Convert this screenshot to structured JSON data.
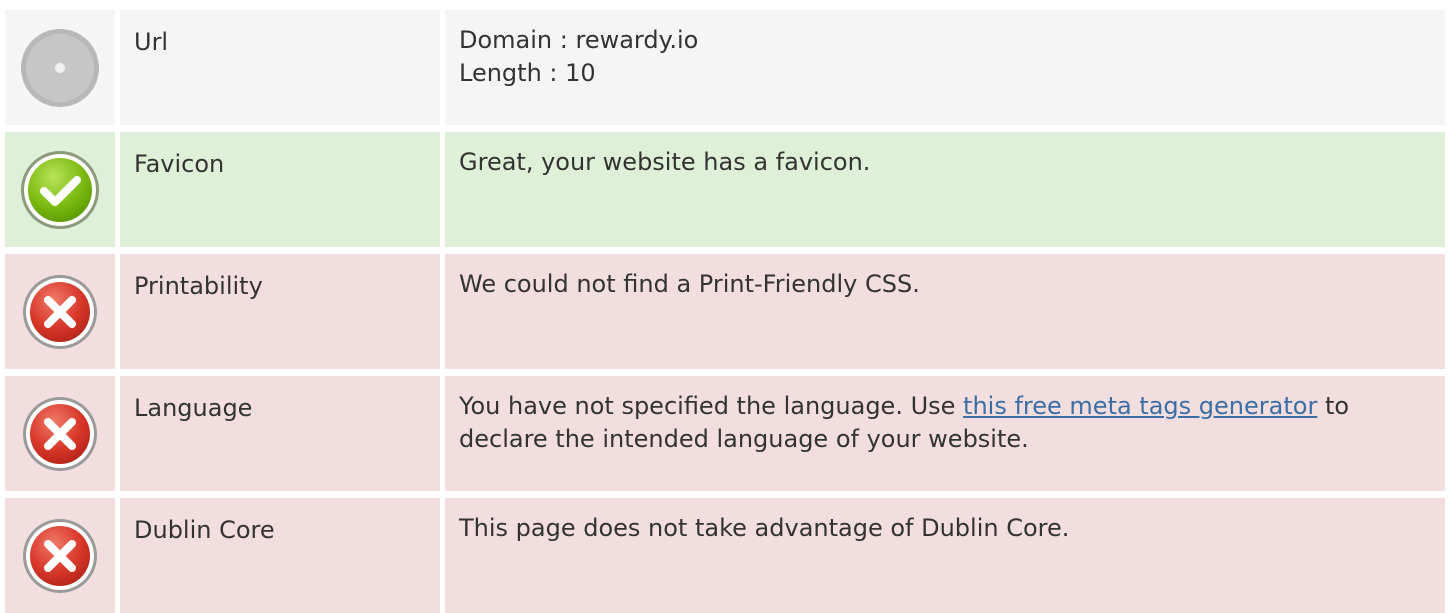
{
  "rows": [
    {
      "status": "neutral",
      "icon": "neutral-circle-icon",
      "label": "Url",
      "lines": [
        "Domain : rewardy.io",
        "Length : 10"
      ]
    },
    {
      "status": "pass",
      "icon": "check-circle-icon",
      "label": "Favicon",
      "text": "Great, your website has a favicon."
    },
    {
      "status": "fail",
      "icon": "cross-circle-icon",
      "label": "Printability",
      "text": "We could not find a Print-Friendly CSS."
    },
    {
      "status": "fail",
      "icon": "cross-circle-icon",
      "label": "Language",
      "text_before": "You have not specified the language. Use ",
      "link_text": "this free meta tags generator",
      "text_after": " to declare the intended language of your website."
    },
    {
      "status": "fail",
      "icon": "cross-circle-icon",
      "label": "Dublin Core",
      "text": "This page does not take advantage of Dublin Core."
    }
  ],
  "colors": {
    "neutral_bg": "#f5f5f5",
    "pass_bg": "#dff0d8",
    "fail_bg": "#f2dede",
    "link": "#3b6ea5"
  }
}
